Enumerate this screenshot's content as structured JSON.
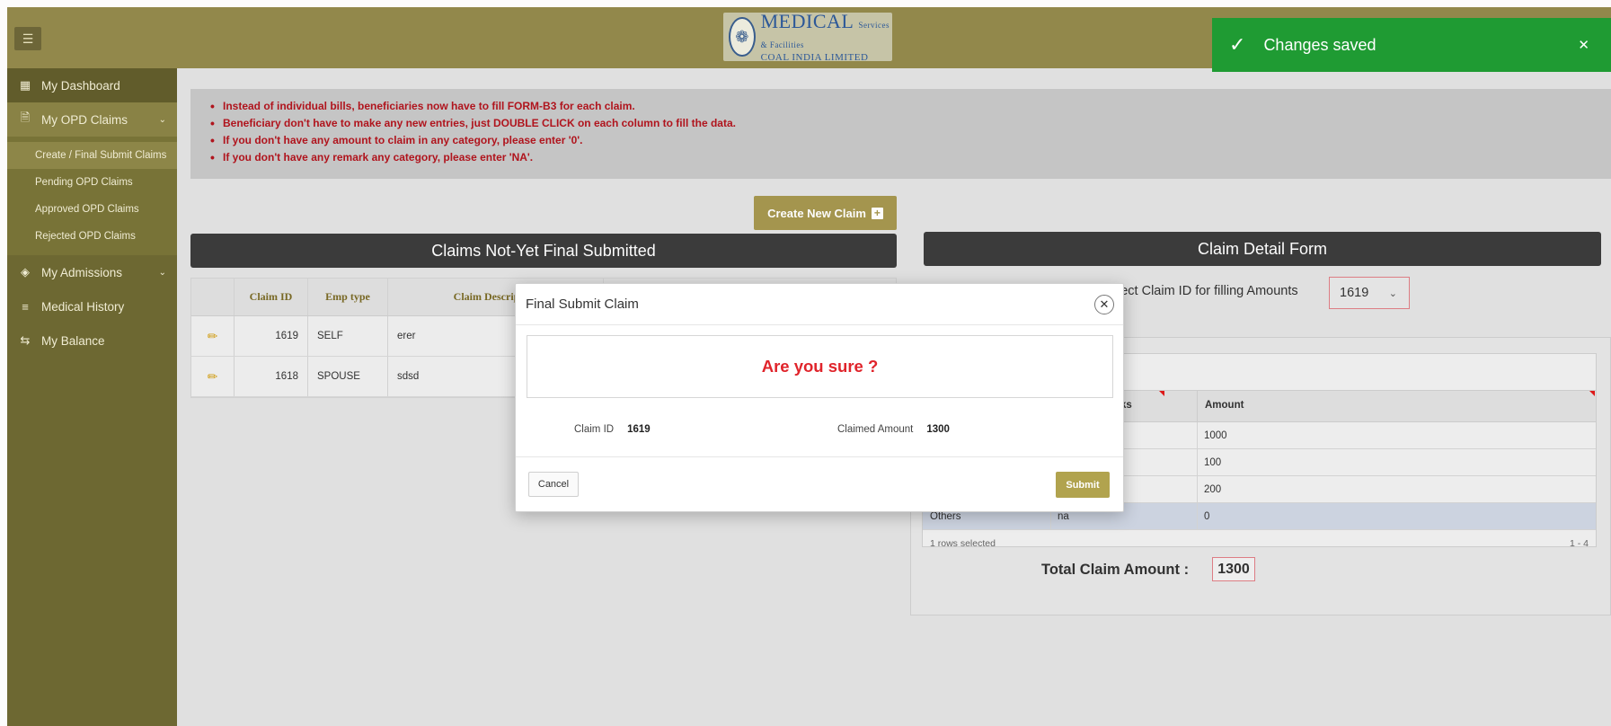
{
  "header": {
    "menu_icon": "hamburger-icon",
    "logo": {
      "main": "MEDICAL",
      "small": "Services & Facilities",
      "sub": "COAL INDIA LIMITED"
    }
  },
  "sidebar": {
    "items": [
      {
        "label": "My Dashboard",
        "icon": "grid-icon"
      },
      {
        "label": "My OPD Claims",
        "icon": "file-icon"
      },
      {
        "label": "My Admissions",
        "icon": "layers-icon"
      },
      {
        "label": "Medical History",
        "icon": "list-check-icon"
      },
      {
        "label": "My Balance",
        "icon": "swap-icon"
      }
    ],
    "opd_sub": [
      {
        "label": "Create / Final Submit Claims"
      },
      {
        "label": "Pending OPD Claims"
      },
      {
        "label": "Approved OPD Claims"
      },
      {
        "label": "Rejected OPD Claims"
      }
    ]
  },
  "notice": [
    "Instead of individual bills, beneficiaries now have to fill FORM-B3 for each claim.",
    "Beneficiary don't have to make any new entries, just DOUBLE CLICK on each column to fill the data.",
    "If you don't have any amount to claim in any category, please enter '0'.",
    "If you don't have any remark any category, please enter 'NA'."
  ],
  "create_button": "Create New Claim",
  "left_panel": {
    "title": "Claims Not-Yet Final Submitted",
    "headers": [
      "Claim ID",
      "Emp type",
      "Claim Description"
    ],
    "rows": [
      {
        "id": "1619",
        "type": "SELF",
        "desc": "erer"
      },
      {
        "id": "1618",
        "type": "SPOUSE",
        "desc": "sdsd"
      }
    ]
  },
  "right_panel": {
    "title": "Claim Detail Form",
    "select_label": "lect Claim ID for filling Amounts",
    "selected_claim": "1619",
    "grid_headers": {
      "remarks": "remarks",
      "amount": "Amount"
    },
    "rows": [
      {
        "name": "",
        "remarks": "",
        "amount": "1000"
      },
      {
        "name": "",
        "remarks": "",
        "amount": "100"
      },
      {
        "name": "",
        "remarks": "",
        "amount": "200"
      },
      {
        "name": "Others",
        "remarks": "na",
        "amount": "0"
      }
    ],
    "footer_left": "1 rows selected",
    "footer_right": "1 - 4",
    "total_label": "Total Claim Amount :",
    "total_value": "1300"
  },
  "modal": {
    "title": "Final Submit Claim",
    "confirm": "Are you sure ?",
    "claim_id_label": "Claim ID",
    "claim_id": "1619",
    "claimed_amount_label": "Claimed Amount",
    "claimed_amount": "1300",
    "cancel": "Cancel",
    "submit": "Submit"
  },
  "toast": {
    "message": "Changes saved"
  }
}
